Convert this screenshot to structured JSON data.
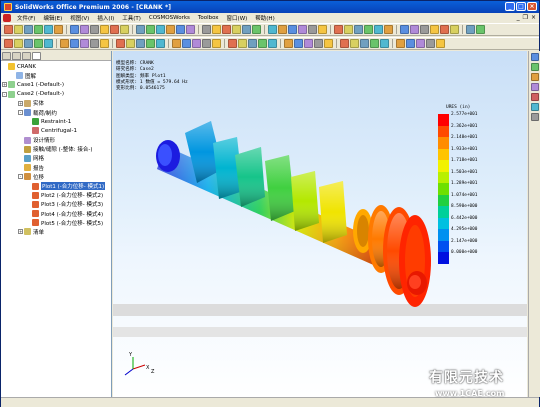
{
  "window": {
    "title": "SolidWorks Office Premium 2006 - [CRANK *]"
  },
  "menu": {
    "items": [
      "文件(F)",
      "编辑(E)",
      "视图(V)",
      "插入(I)",
      "工具(T)",
      "COSMOSWorks",
      "Toolbox",
      "窗口(W)",
      "帮助(H)"
    ]
  },
  "tree": {
    "items": [
      {
        "label": "CRANK",
        "indent": 0,
        "expander": "",
        "icon_color": "#f2c230"
      },
      {
        "label": "图解",
        "indent": 1,
        "expander": "",
        "icon_color": "#8fb4e6"
      },
      {
        "label": "Case1 (-Default-)",
        "indent": 0,
        "expander": "+",
        "icon_color": "#8ed08e"
      },
      {
        "label": "Case2 (-Default-)",
        "indent": 0,
        "expander": "-",
        "icon_color": "#8ed08e"
      },
      {
        "label": "实体",
        "indent": 2,
        "expander": "+",
        "icon_color": "#c9a96a"
      },
      {
        "label": "载荷/制约",
        "indent": 2,
        "expander": "-",
        "icon_color": "#6a8fd0"
      },
      {
        "label": "Restraint-1",
        "indent": 3,
        "expander": "",
        "icon_color": "#3aa33a"
      },
      {
        "label": "Centrifugal-1",
        "indent": 3,
        "expander": "",
        "icon_color": "#d06a6a"
      },
      {
        "label": "设计情形",
        "indent": 2,
        "expander": "",
        "icon_color": "#b08fd0"
      },
      {
        "label": "接触/缝隙 (-整体: 接合-)",
        "indent": 2,
        "expander": "",
        "icon_color": "#c0a040"
      },
      {
        "label": "网格",
        "indent": 2,
        "expander": "",
        "icon_color": "#5aa0c8"
      },
      {
        "label": "报告",
        "indent": 2,
        "expander": "",
        "icon_color": "#e0b040"
      },
      {
        "label": "位移",
        "indent": 2,
        "expander": "-",
        "icon_color": "#d09040"
      },
      {
        "label": "Plot1 (-合力位移- 模式1)",
        "indent": 3,
        "expander": "",
        "icon_color": "#e06030",
        "selected": true
      },
      {
        "label": "Plot2 (-合力位移- 模式2)",
        "indent": 3,
        "expander": "",
        "icon_color": "#e06030"
      },
      {
        "label": "Plot3 (-合力位移- 模式3)",
        "indent": 3,
        "expander": "",
        "icon_color": "#e06030"
      },
      {
        "label": "Plot4 (-合力位移- 模式4)",
        "indent": 3,
        "expander": "",
        "icon_color": "#e06030"
      },
      {
        "label": "Plot5 (-合力位移- 模式5)",
        "indent": 3,
        "expander": "",
        "icon_color": "#e06030"
      },
      {
        "label": "清单",
        "indent": 2,
        "expander": "+",
        "icon_color": "#d0c060"
      }
    ]
  },
  "plot_info": {
    "lines": [
      "模型名称: CRANK",
      "研究名称: Case2",
      "图解类型: 频率 Plot1",
      "模式形状: 1  数值 =     579.64 Hz",
      "变形比例: 0.0546175"
    ]
  },
  "legend": {
    "title": "URES (in)",
    "values": [
      "2.577e+001",
      "2.362e+001",
      "2.148e+001",
      "1.933e+001",
      "1.718e+001",
      "1.503e+001",
      "1.289e+001",
      "1.074e+001",
      "8.590e+000",
      "6.442e+000",
      "4.295e+000",
      "2.147e+000",
      "0.000e+000"
    ],
    "colors": [
      "#ff0000",
      "#ff4a00",
      "#ff8c00",
      "#ffc400",
      "#f2f200",
      "#b8f000",
      "#6ee000",
      "#20d040",
      "#00d09a",
      "#00c0e0",
      "#0090f0",
      "#0050f0",
      "#0010e0"
    ]
  },
  "axis": {
    "x_label": "X",
    "y_label": "Y",
    "z_label": "Z"
  },
  "watermark": {
    "text_cn": "有限元技术",
    "url": "www.1CAE.com"
  },
  "colors": {
    "title_bar": "#0842b8",
    "selection": "#316ac5",
    "chrome": "#ece9d8"
  }
}
